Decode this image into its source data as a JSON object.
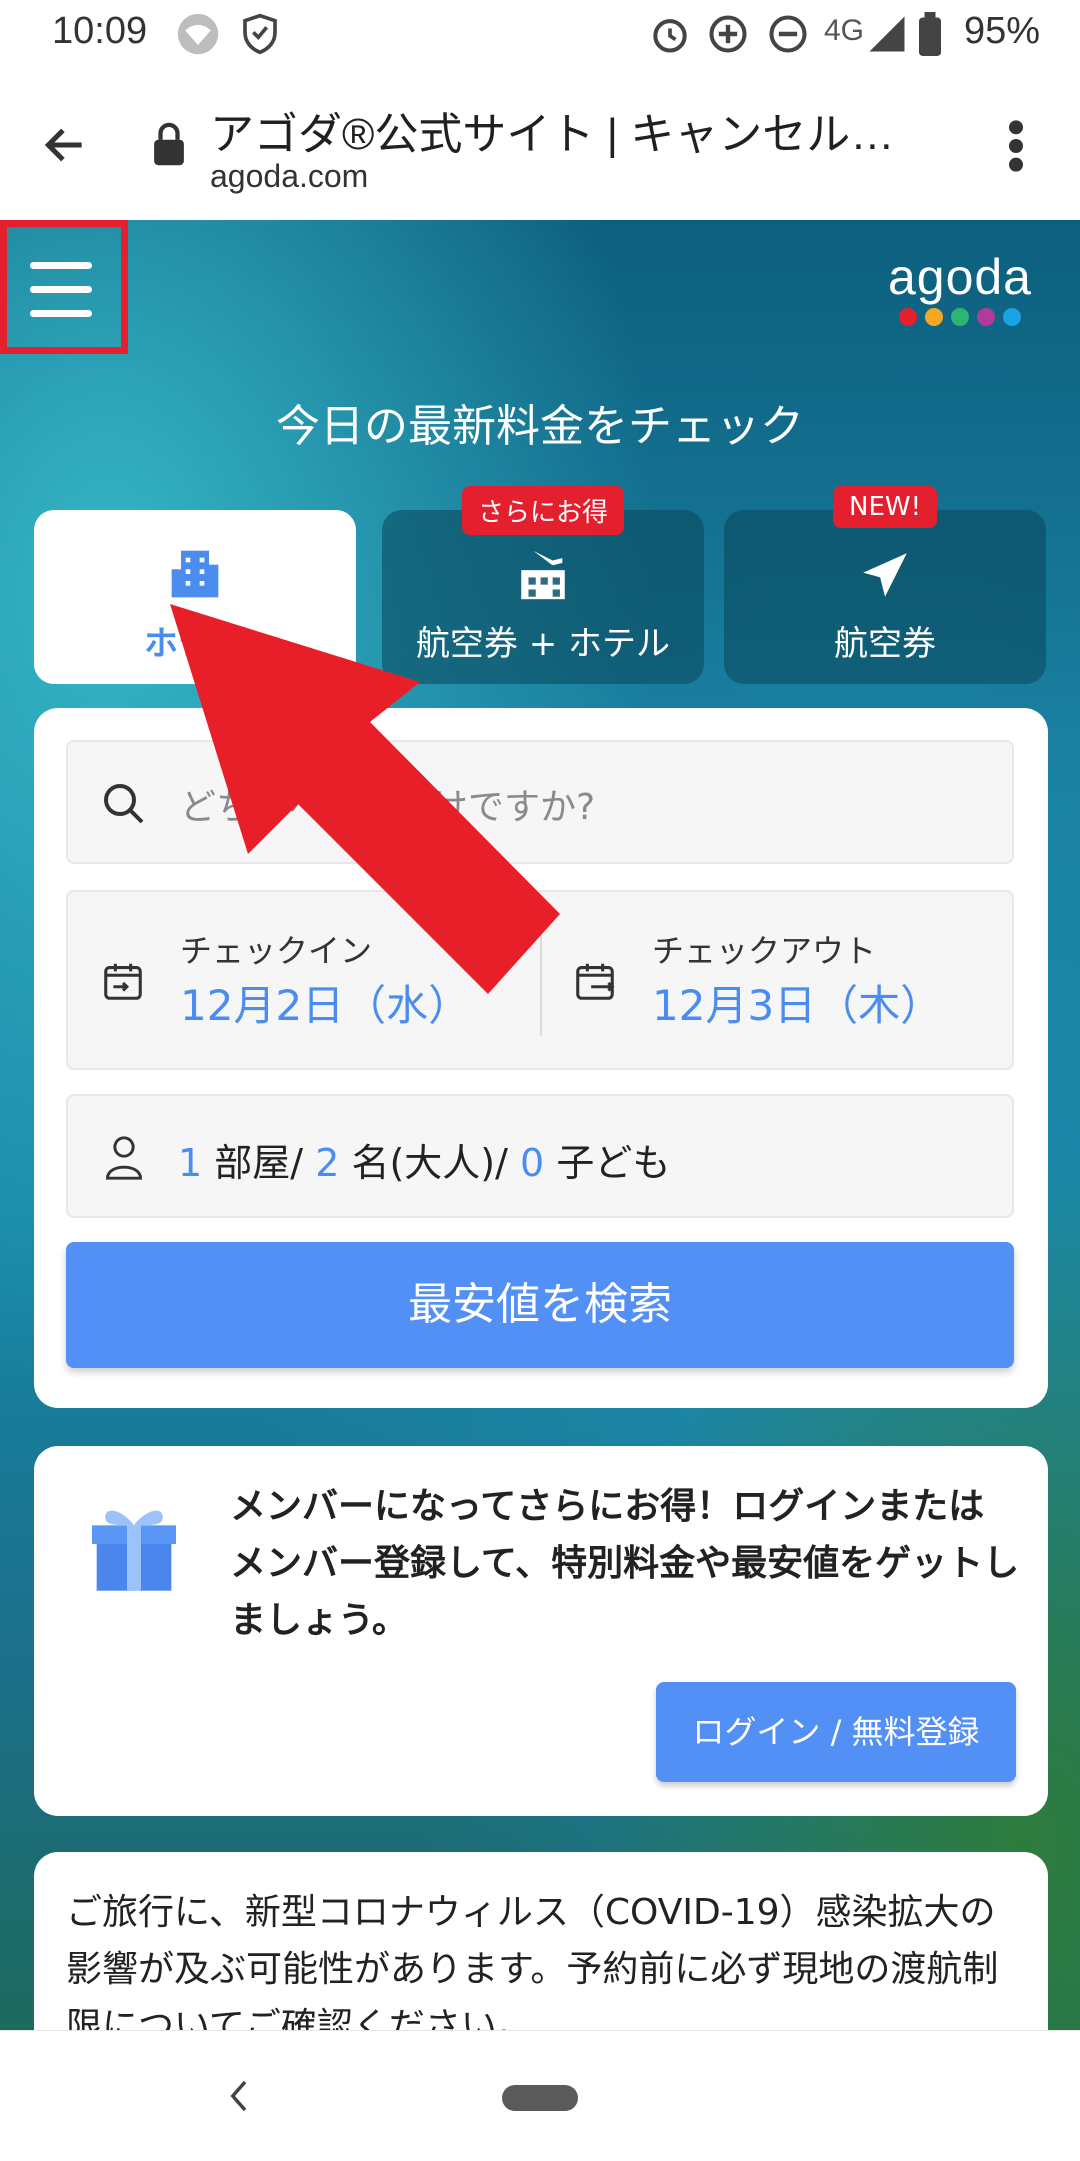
{
  "status_bar": {
    "time": "10:09",
    "network": "4G",
    "battery": "95%",
    "icons": [
      "wifi-icon",
      "shield-icon",
      "alarm-icon",
      "data-saver-icon",
      "dnd-icon",
      "signal-icon",
      "battery-icon"
    ]
  },
  "browser": {
    "title": "アゴダ®公式サイト | キャンセル無料の格安ホテル予約",
    "url": "agoda.com",
    "icons": [
      "back-arrow-icon",
      "lock-icon",
      "more-vert-icon"
    ]
  },
  "hero": {
    "logo_text": "agoda",
    "logo_dot_colors": [
      "#e4202f",
      "#f5a623",
      "#2bb673",
      "#b3399b",
      "#1ba3e6"
    ],
    "title": "今日の最新料金をチェック",
    "tabs": [
      {
        "label": "ホテル",
        "active": true,
        "icon": "hotel-building-icon"
      },
      {
        "label": "航空券 + ホテル",
        "badge": "さらにお得",
        "icon": "flight-hotel-icon"
      },
      {
        "label": "航空券",
        "badge": "NEW!",
        "icon": "plane-icon"
      }
    ]
  },
  "search": {
    "placeholder": "どちらへお出かけですか?",
    "checkin_label": "チェックイン",
    "checkin_value": "12月2日（水）",
    "checkout_label": "チェックアウト",
    "checkout_value": "12月3日（木）",
    "rooms": "1",
    "rooms_unit": "部屋/",
    "adults": "2",
    "adults_unit": "名(大人)/",
    "children": "0",
    "children_unit": "子ども",
    "button_label": "最安値を検索"
  },
  "member": {
    "text": "メンバーになってさらにお得！ログインまたはメンバー登録して、特別料金や最安値をゲットしましょう。",
    "button_label": "ログイン / 無料登録"
  },
  "notice": {
    "text": "ご旅行に、新型コロナウィルス（COVID-19）感染拡大の影響が及ぶ可能性があります。予約前に必ず現地の渡航制限についてご確認ください。"
  },
  "colors": {
    "accent_blue": "#5390f5",
    "date_blue": "#4a8cf0",
    "highlight_red": "#e4202f"
  }
}
